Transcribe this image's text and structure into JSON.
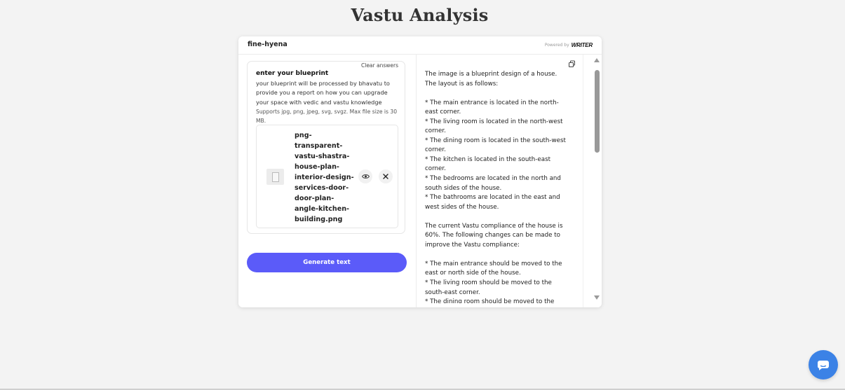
{
  "page": {
    "title": "Vastu Analysis"
  },
  "app": {
    "name": "fine-hyena",
    "powered_by": "Powered by",
    "powered_brand": "WRITER"
  },
  "form": {
    "clear_answers": "Clear answers",
    "field_label": "enter your blueprint",
    "field_description": "your blueprint will be processed by bhavatu to provide you a report on how you can upgrade your space with vedic and vastu knowledge",
    "field_hint": "Supports jpg, png, jpeg, svg, svgz. Max file size is 30 MB.",
    "file_name": "png-transparent-vastu-shastra-house-plan-interior-design-services-door-door-plan-angle-kitchen-building.png",
    "generate_label": "Generate text"
  },
  "output": {
    "lines": [
      "The image is a blueprint design of a house.",
      "The layout is as follows:",
      "",
      "* The main entrance is located in the north-",
      "east corner.",
      "* The living room is located in the north-west",
      "corner.",
      "* The dining room is located in the south-west",
      "corner.",
      "* The kitchen is located in the south-east",
      "corner.",
      "* The bedrooms are located in the north and",
      "south sides of the house.",
      "* The bathrooms are located in the east and",
      "west sides of the house.",
      "",
      "The current Vastu compliance of the house is",
      "60%. The following changes can be made to",
      "improve the Vastu compliance:",
      "",
      "* The main entrance should be moved to the",
      "east or north side of the house.",
      "* The living room should be moved to the",
      "south-east corner.",
      "* The dining room should be moved to the"
    ]
  },
  "icons": {
    "copy": "copy-icon",
    "eye": "eye-icon",
    "close": "close-icon",
    "chat": "chat-icon"
  },
  "colors": {
    "accent": "#5b5bf9",
    "chat_button": "#3b82e6",
    "background": "#f3f3f3"
  }
}
